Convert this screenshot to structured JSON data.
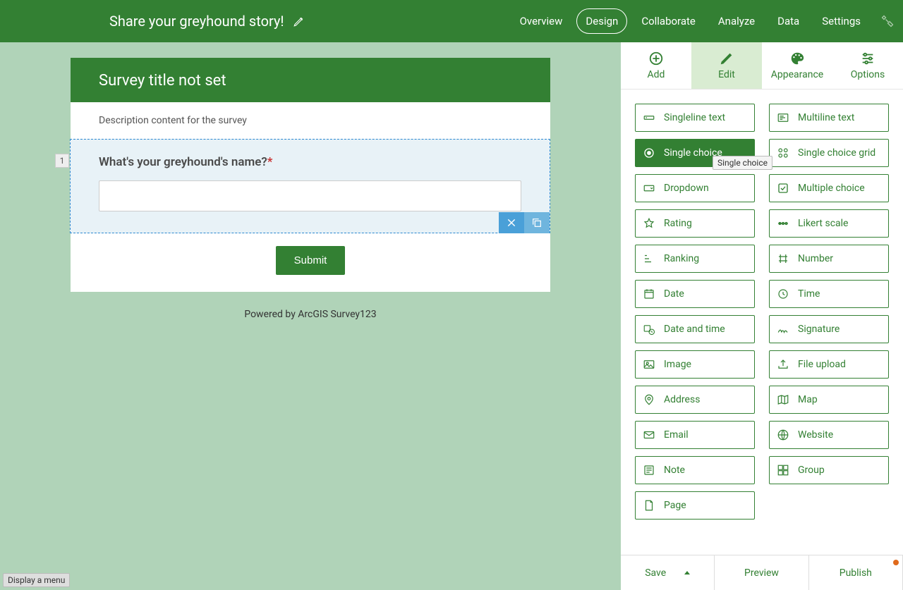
{
  "header": {
    "survey_name": "Share your greyhound story!",
    "nav": [
      "Overview",
      "Design",
      "Collaborate",
      "Analyze",
      "Data",
      "Settings"
    ],
    "active_nav": "Design"
  },
  "survey": {
    "title": "Survey title not set",
    "description": "Description content for the survey",
    "submit_label": "Submit",
    "powered": "Powered by ArcGIS Survey123",
    "question": {
      "number": "1",
      "label": "What's your greyhound's name?",
      "required_mark": "*"
    }
  },
  "sidebar": {
    "tabs": [
      "Add",
      "Edit",
      "Appearance",
      "Options"
    ],
    "active_tab": "Edit",
    "tooltip": "Single choice",
    "question_types": [
      "Singleline text",
      "Multiline text",
      "Single choice",
      "Single choice grid",
      "Dropdown",
      "Multiple choice",
      "Rating",
      "Likert scale",
      "Ranking",
      "Number",
      "Date",
      "Time",
      "Date and time",
      "Signature",
      "Image",
      "File upload",
      "Address",
      "Map",
      "Email",
      "Website",
      "Note",
      "Group",
      "Page"
    ],
    "selected_type": "Single choice"
  },
  "footer": {
    "save": "Save",
    "preview": "Preview",
    "publish": "Publish"
  },
  "browser_hint": "Display a menu"
}
